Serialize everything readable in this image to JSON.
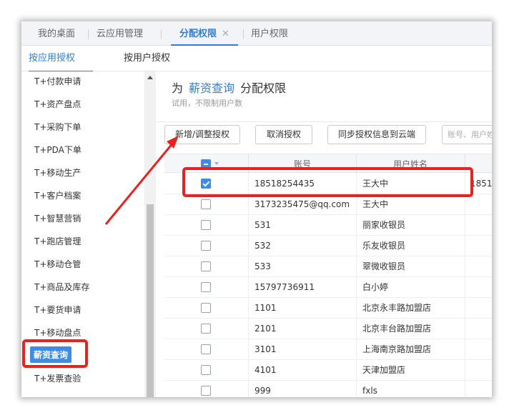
{
  "top_tabs": [
    {
      "label": "我的桌面"
    },
    {
      "label": "云应用管理"
    },
    {
      "label": "分配权限",
      "close": "✕"
    },
    {
      "label": "用户权限"
    }
  ],
  "sub_tabs": [
    {
      "label": "按应用授权"
    },
    {
      "label": "按用户授权"
    }
  ],
  "app_list": [
    "T+付款申请",
    "T+资产盘点",
    "T+采购下单",
    "T+PDA下单",
    "T+移动生产",
    "T+客户档案",
    "T+智慧营销",
    "T+跑店管理",
    "T+移动仓管",
    "T+商品及库存",
    "T+要货申请",
    "T+移动盘点",
    "薪资查询",
    "T+发票查验"
  ],
  "header": {
    "prefix": "为",
    "app_name": "薪资查询",
    "suffix": "分配权限",
    "subtitle": "试用，不限制用户数"
  },
  "toolbar": {
    "add_button": "新增/调整授权",
    "cancel_button": "取消授权",
    "sync_button": "同步授权信息到云端",
    "search_placeholder": "账号、用户姓名"
  },
  "table": {
    "columns": [
      "账号",
      "用户姓名"
    ],
    "rows": [
      {
        "account": "18518254435",
        "name": "王大中",
        "extra": "1851",
        "checked": true
      },
      {
        "account": "3173235475@qq.com",
        "name": "王大中",
        "extra": "",
        "checked": false
      },
      {
        "account": "531",
        "name": "丽家收银员",
        "extra": "",
        "checked": false
      },
      {
        "account": "532",
        "name": "乐友收银员",
        "extra": "",
        "checked": false
      },
      {
        "account": "533",
        "name": "翠微收银员",
        "extra": "",
        "checked": false
      },
      {
        "account": "15797736911",
        "name": "白小婷",
        "extra": "",
        "checked": false
      },
      {
        "account": "1101",
        "name": "北京永丰路加盟店",
        "extra": "",
        "checked": false
      },
      {
        "account": "2101",
        "name": "北京丰台路加盟店",
        "extra": "",
        "checked": false
      },
      {
        "account": "3101",
        "name": "上海南京路加盟店",
        "extra": "",
        "checked": false
      },
      {
        "account": "4101",
        "name": "天津加盟店",
        "extra": "",
        "checked": false
      },
      {
        "account": "999",
        "name": "fxls",
        "extra": "",
        "checked": false
      }
    ]
  },
  "colors": {
    "accent": "#2d7fdc",
    "annotation": "#e8231f"
  }
}
